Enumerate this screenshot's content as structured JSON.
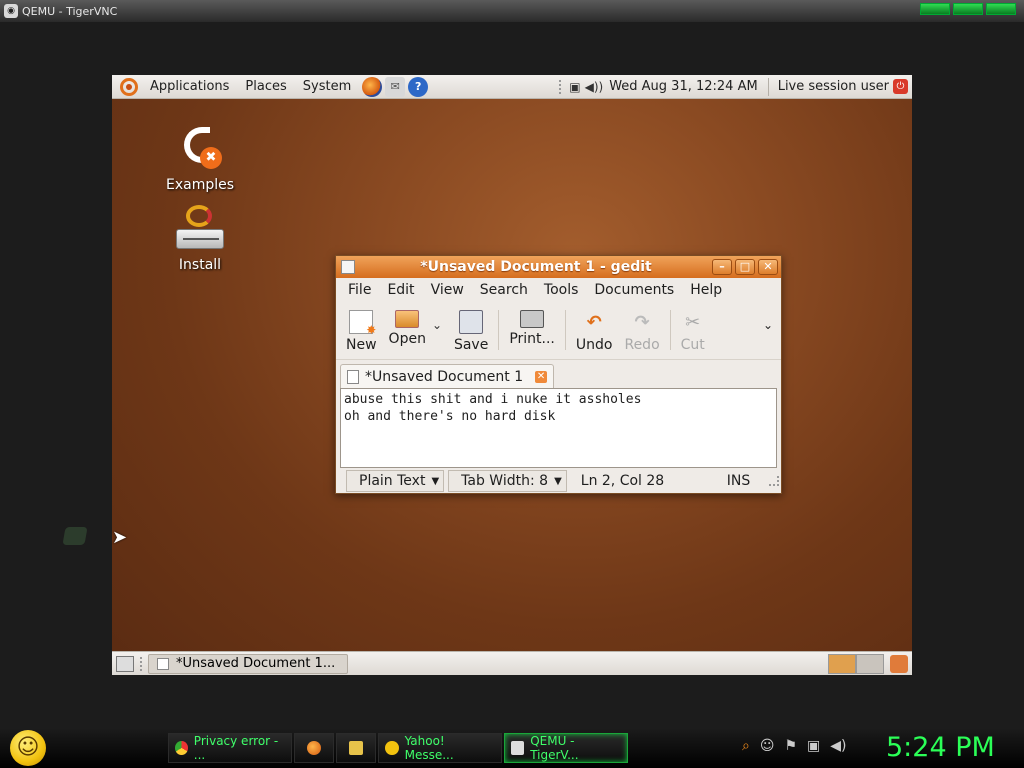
{
  "host": {
    "window_title": "QEMU - TigerVNC",
    "taskbar": {
      "start_icon": "smiley-icon",
      "tasks": [
        {
          "label": "Privacy error - ...",
          "icon": "chrome-icon"
        },
        {
          "label": "",
          "icon": "firefox-icon"
        },
        {
          "label": "",
          "icon": "files-icon"
        },
        {
          "label": "Yahoo! Messe...",
          "icon": "yahoo-icon"
        },
        {
          "label": "QEMU - TigerV...",
          "icon": "vnc-icon",
          "active": true
        }
      ],
      "tray_icons": [
        "search-icon",
        "emoticon-icon",
        "flag-icon",
        "network-icon",
        "volume-icon"
      ],
      "clock": "5:24 PM"
    },
    "accent_color": "#2bff57"
  },
  "guest": {
    "top_panel": {
      "menus": [
        "Applications",
        "Places",
        "System"
      ],
      "launchers": [
        "firefox-icon",
        "mail-icon",
        "help-icon"
      ],
      "datetime": "Wed Aug 31, 12:24 AM",
      "session_user": "Live session user"
    },
    "desktop_icons": [
      {
        "label": "Examples",
        "icon": "examples-icon"
      },
      {
        "label": "Install",
        "icon": "install-icon"
      }
    ],
    "gedit": {
      "title": "*Unsaved Document 1 - gedit",
      "menu": [
        "File",
        "Edit",
        "View",
        "Search",
        "Tools",
        "Documents",
        "Help"
      ],
      "toolbar": {
        "new": "New",
        "open": "Open",
        "save": "Save",
        "print": "Print...",
        "undo": "Undo",
        "redo": "Redo",
        "cut": "Cut"
      },
      "tab_label": "*Unsaved Document 1",
      "text": "abuse this shit and i nuke it assholes\noh and there's no hard disk",
      "status": {
        "syntax": "Plain Text",
        "tab_width": "Tab Width:  8",
        "cursor": "Ln 2, Col 28",
        "mode": "INS"
      }
    },
    "bottom_panel": {
      "task_label": "*Unsaved Document 1..."
    },
    "window_accent": "#d56d1e"
  }
}
